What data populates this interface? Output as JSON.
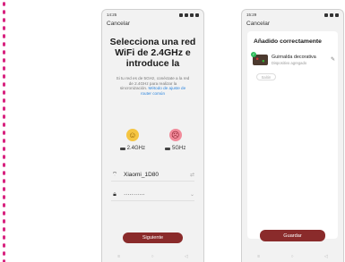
{
  "left_screen": {
    "status": {
      "time": "14:25"
    },
    "cancel_label": "Cancelar",
    "title": "Selecciona una red WiFi de 2.4GHz e introduce la",
    "hint_text": "Si tu red es de 5GHz, conéctate a la red de 2.4GHz para realizar la sincronización.",
    "hint_link": "Método de ajuste de router común",
    "bands": [
      {
        "face": "☺",
        "label": "2.4GHz"
      },
      {
        "face": "☹",
        "label": "5GHz"
      }
    ],
    "wifi_name": "Xiaomi_1D80",
    "password_mask": "···········",
    "next_label": "Siguiente"
  },
  "right_screen": {
    "status": {
      "time": "15:29"
    },
    "cancel_label": "Cancelar",
    "card_title": "Añadido correctamente",
    "device_name": "Guirnalda decorativa",
    "device_status": "Dispositivo agregado",
    "room_chip": "Salón",
    "save_label": "Guardar"
  },
  "colors": {
    "accent": "#8a2b2b",
    "dots": "#d8237f",
    "check": "#2ebc5b"
  }
}
